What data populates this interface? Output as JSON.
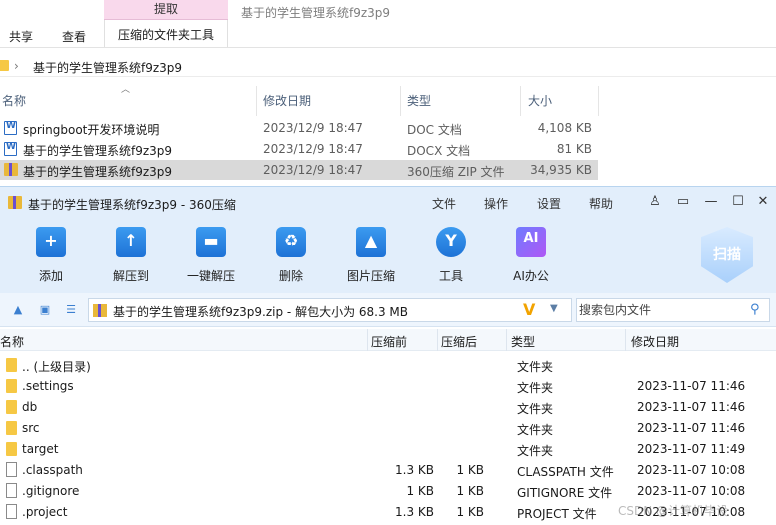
{
  "explorer": {
    "ribbon": {
      "extract_tab": "提取",
      "window_title": "基于的学生管理系统f9z3p9",
      "tabs": [
        "共享",
        "查看",
        "压缩的文件夹工具"
      ]
    },
    "address": "基于的学生管理系统f9z3p9",
    "columns": {
      "name": "名称",
      "date": "修改日期",
      "type": "类型",
      "size": "大小"
    },
    "files": [
      {
        "name": "springboot开发环境说明",
        "date": "2023/12/9 18:47",
        "type": "DOC 文档",
        "size": "4,108 KB",
        "icon": "word-doc-icon"
      },
      {
        "name": "基于的学生管理系统f9z3p9",
        "date": "2023/12/9 18:47",
        "type": "DOCX 文档",
        "size": "81 KB",
        "icon": "word-doc-icon"
      },
      {
        "name": "基于的学生管理系统f9z3p9",
        "date": "2023/12/9 18:47",
        "type": "360压缩 ZIP 文件",
        "size": "34,935 KB",
        "icon": "zip-archive-icon"
      }
    ]
  },
  "zip_window": {
    "title": "基于的学生管理系统f9z3p9 - 360压缩",
    "menu": [
      "文件",
      "操作",
      "设置",
      "帮助"
    ],
    "window_controls": [
      "shirt-skin-icon",
      "feedback-icon",
      "minimize-icon",
      "maximize-icon",
      "close-icon"
    ],
    "toolbar": [
      {
        "label": "添加",
        "icon": "add-icon"
      },
      {
        "label": "解压到",
        "icon": "extract-to-icon"
      },
      {
        "label": "一键解压",
        "icon": "one-click-extract-icon"
      },
      {
        "label": "删除",
        "icon": "delete-icon"
      },
      {
        "label": "图片压缩",
        "icon": "image-compress-icon"
      },
      {
        "label": "工具",
        "icon": "tools-icon"
      },
      {
        "label": "AI办公",
        "icon": "ai-office-icon"
      }
    ],
    "ai_icon_text": "AI",
    "scan_label": "扫描",
    "path": "基于的学生管理系统f9z3p9.zip - 解包大小为 68.3 MB",
    "search_placeholder": "搜索包内文件",
    "columns": {
      "name": "名称",
      "packed": "压缩前",
      "unpacked": "压缩后",
      "type": "类型",
      "date": "修改日期"
    },
    "entries": [
      {
        "name": ".. (上级目录)",
        "packed": "",
        "unpacked": "",
        "type": "文件夹",
        "date": "",
        "kind": "folder"
      },
      {
        "name": ".settings",
        "packed": "",
        "unpacked": "",
        "type": "文件夹",
        "date": "2023-11-07 11:46",
        "kind": "folder"
      },
      {
        "name": "db",
        "packed": "",
        "unpacked": "",
        "type": "文件夹",
        "date": "2023-11-07 11:46",
        "kind": "folder"
      },
      {
        "name": "src",
        "packed": "",
        "unpacked": "",
        "type": "文件夹",
        "date": "2023-11-07 11:46",
        "kind": "folder"
      },
      {
        "name": "target",
        "packed": "",
        "unpacked": "",
        "type": "文件夹",
        "date": "2023-11-07 11:49",
        "kind": "folder"
      },
      {
        "name": ".classpath",
        "packed": "1.3 KB",
        "unpacked": "1 KB",
        "type": "CLASSPATH 文件",
        "date": "2023-11-07 10:08",
        "kind": "file"
      },
      {
        "name": ".gitignore",
        "packed": "1 KB",
        "unpacked": "1 KB",
        "type": "GITIGNORE 文件",
        "date": "2023-11-07 10:08",
        "kind": "file"
      },
      {
        "name": ".project",
        "packed": "1.3 KB",
        "unpacked": "1 KB",
        "type": "PROJECT 文件",
        "date": "2023-11-07 10:08",
        "kind": "file"
      }
    ]
  },
  "watermark": "CSDN @计算机毕设"
}
